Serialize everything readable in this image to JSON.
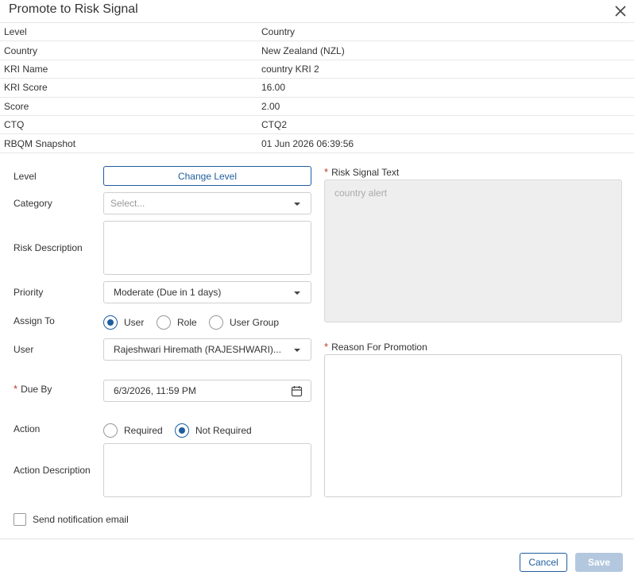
{
  "dialog": {
    "title": "Promote to Risk Signal",
    "close_icon": "close-icon"
  },
  "info": [
    {
      "label": "Level",
      "value": "Country"
    },
    {
      "label": "Country",
      "value": "New Zealand (NZL)"
    },
    {
      "label": "KRI Name",
      "value": "country KRI 2"
    },
    {
      "label": "KRI Score",
      "value": "16.00"
    },
    {
      "label": "Score",
      "value": "2.00"
    },
    {
      "label": "CTQ",
      "value": "CTQ2"
    },
    {
      "label": "RBQM Snapshot",
      "value": "01 Jun 2026 06:39:56"
    }
  ],
  "form": {
    "level_label": "Level",
    "change_level_button": "Change Level",
    "category_label": "Category",
    "category_placeholder": "Select...",
    "risk_description_label": "Risk Description",
    "priority_label": "Priority",
    "priority_value": "Moderate (Due in 1 days)",
    "assign_to_label": "Assign To",
    "assign_options": [
      "User",
      "Role",
      "User Group"
    ],
    "assign_selected": "User",
    "user_label": "User",
    "user_value": "Rajeshwari Hiremath (RAJESHWARI)...",
    "due_by_required": "*",
    "due_by_label": "Due By",
    "due_by_value": "6/3/2026, 11:59 PM",
    "action_label": "Action",
    "action_options": [
      "Required",
      "Not Required"
    ],
    "action_selected": "Not Required",
    "action_description_label": "Action Description",
    "risk_signal_text_required": "*",
    "risk_signal_text_label": "Risk Signal Text",
    "risk_signal_text_value": "country alert",
    "reason_required": "*",
    "reason_label": "Reason For Promotion",
    "send_notification_label": "Send notification email"
  },
  "footer": {
    "cancel_label": "Cancel",
    "save_label": "Save"
  },
  "colors": {
    "accent": "#1f5e9e",
    "required": "#c0392b",
    "save_disabled": "#b3c8de"
  }
}
